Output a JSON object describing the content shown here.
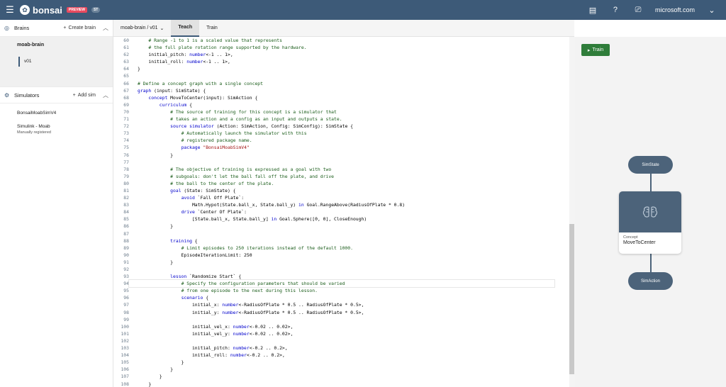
{
  "header": {
    "menu_icon": "hamburger-icon",
    "brand_name": "bonsai",
    "preview_badge": "PREVIEW",
    "version_badge": "ST",
    "account": "microsoft.com",
    "icons": [
      "notes-icon",
      "help-icon",
      "feedback-icon"
    ]
  },
  "sidebar": {
    "brains_title": "Brains",
    "create_brain": "Create brain",
    "brain_name": "moab-brain",
    "brain_version": "v01",
    "simulators_title": "Simulators",
    "add_sim": "Add sim",
    "simulators": [
      {
        "name": "BonsaiMoabSimV4",
        "sub": ""
      },
      {
        "name": "Simulink - Moab",
        "sub": "Manually registered"
      }
    ]
  },
  "tabs": {
    "breadcrumb": "moab-brain / v01",
    "teach": "Teach",
    "train": "Train"
  },
  "editor": {
    "lines": [
      {
        "n": "60",
        "t": "    # Range -1 to 1 is a scaled value that represents"
      },
      {
        "n": "61",
        "t": "    # the full plate rotation range supported by the hardware."
      },
      {
        "n": "62",
        "t": "    initial_pitch: number<-1 .. 1>,"
      },
      {
        "n": "63",
        "t": "    initial_roll: number<-1 .. 1>,"
      },
      {
        "n": "64",
        "t": "}"
      },
      {
        "n": "65",
        "t": ""
      },
      {
        "n": "66",
        "t": "# Define a concept graph with a single concept"
      },
      {
        "n": "67",
        "t": "graph (input: SimState) {"
      },
      {
        "n": "68",
        "t": "    concept MoveToCenter(input): SimAction {"
      },
      {
        "n": "69",
        "t": "        curriculum {"
      },
      {
        "n": "70",
        "t": "            # The source of training for this concept is a simulator that"
      },
      {
        "n": "71",
        "t": "            # takes an action and a config as an input and outputs a state."
      },
      {
        "n": "72",
        "t": "            source simulator (Action: SimAction, Config: SimConfig): SimState {"
      },
      {
        "n": "73",
        "t": "                # Automatically launch the simulator with this"
      },
      {
        "n": "74",
        "t": "                # registered package name."
      },
      {
        "n": "75",
        "t": "                package \"BonsaiMoabSimV4\""
      },
      {
        "n": "76",
        "t": "            }"
      },
      {
        "n": "77",
        "t": ""
      },
      {
        "n": "78",
        "t": "            # The objective of training is expressed as a goal with two"
      },
      {
        "n": "79",
        "t": "            # subgoals: don't let the ball fall off the plate, and drive"
      },
      {
        "n": "80",
        "t": "            # the ball to the center of the plate."
      },
      {
        "n": "81",
        "t": "            goal (State: SimState) {"
      },
      {
        "n": "82",
        "t": "                avoid `Fall Off Plate`:"
      },
      {
        "n": "83",
        "t": "                    Math.Hypot(State.ball_x, State.ball_y) in Goal.RangeAbove(RadiusOfPlate * 0.8)"
      },
      {
        "n": "84",
        "t": "                drive `Center Of Plate`:"
      },
      {
        "n": "85",
        "t": "                    [State.ball_x, State.ball_y] in Goal.Sphere([0, 0], CloseEnough)"
      },
      {
        "n": "86",
        "t": "            }"
      },
      {
        "n": "87",
        "t": ""
      },
      {
        "n": "88",
        "t": "            training {"
      },
      {
        "n": "89",
        "t": "                # Limit episodes to 250 iterations instead of the default 1000."
      },
      {
        "n": "90",
        "t": "                EpisodeIterationLimit: 250"
      },
      {
        "n": "91",
        "t": "            }"
      },
      {
        "n": "92",
        "t": ""
      },
      {
        "n": "93",
        "t": "            lesson `Randomize Start` {"
      },
      {
        "n": "94",
        "t": "                # Specify the configuration parameters that should be varied"
      },
      {
        "n": "95",
        "t": "                # from one episode to the next during this lesson."
      },
      {
        "n": "96",
        "t": "                scenario {"
      },
      {
        "n": "97",
        "t": "                    initial_x: number<-RadiusOfPlate * 0.5 .. RadiusOfPlate * 0.5>,"
      },
      {
        "n": "98",
        "t": "                    initial_y: number<-RadiusOfPlate * 0.5 .. RadiusOfPlate * 0.5>,"
      },
      {
        "n": "99",
        "t": ""
      },
      {
        "n": "100",
        "t": "                    initial_vel_x: number<-0.02 .. 0.02>,"
      },
      {
        "n": "101",
        "t": "                    initial_vel_y: number<-0.02 .. 0.02>,"
      },
      {
        "n": "102",
        "t": ""
      },
      {
        "n": "103",
        "t": "                    initial_pitch: number<-0.2 .. 0.2>,"
      },
      {
        "n": "104",
        "t": "                    initial_roll: number<-0.2 .. 0.2>,"
      },
      {
        "n": "105",
        "t": "                }"
      },
      {
        "n": "106",
        "t": "            }"
      },
      {
        "n": "107",
        "t": "        }"
      },
      {
        "n": "108",
        "t": "    }"
      }
    ],
    "highlighted_line": "94"
  },
  "graph": {
    "train_button": "Train",
    "input_node": "SimState",
    "concept_label": "Concept",
    "concept_name": "MoveToCenter",
    "output_node": "SimAction",
    "concept_icon": "brain-icon"
  },
  "colors": {
    "header_bg": "#3d5a78",
    "node_bg": "#4c637a",
    "train_button_bg": "#2f7d3a",
    "keyword": "#0000cc",
    "comment": "#1a5c1a",
    "string": "#a31515"
  }
}
